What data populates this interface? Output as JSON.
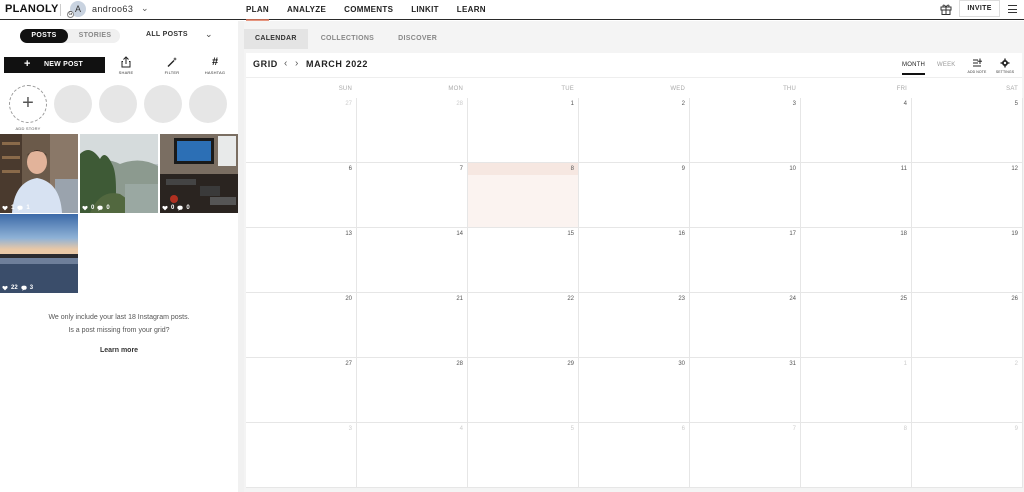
{
  "app": {
    "logo": "PLANOLY",
    "account": {
      "avatar_letter": "A",
      "badge": "G",
      "username": "androo63"
    }
  },
  "nav": {
    "items": [
      "PLAN",
      "ANALYZE",
      "COMMENTS",
      "LINKIT",
      "LEARN"
    ],
    "active": "PLAN"
  },
  "topright": {
    "invite_label": "INVITE"
  },
  "left": {
    "segment": {
      "posts": "POSTS",
      "stories": "STORIES"
    },
    "filter_select": "ALL POSTS",
    "new_post_label": "NEW POST",
    "tools": {
      "share": "SHARE",
      "filter": "FILTER",
      "hashtag": "HASHTAG"
    },
    "add_story_label": "ADD STORY",
    "posts": [
      {
        "likes": "1",
        "comments": "1"
      },
      {
        "likes": "0",
        "comments": "0"
      },
      {
        "likes": "0",
        "comments": "0"
      },
      {
        "likes": "22",
        "comments": "3"
      }
    ],
    "info_line1": "We only include your last 18 Instagram posts.",
    "info_line2": "Is a post missing from your grid?",
    "learn_more": "Learn more"
  },
  "right": {
    "tabs": [
      "CALENDAR",
      "COLLECTIONS",
      "DISCOVER"
    ],
    "active_tab": "CALENDAR",
    "calendar": {
      "view_label": "GRID",
      "month": "MARCH 2022",
      "view_month": "MONTH",
      "view_week": "WEEK",
      "add_note": "ADD NOTE",
      "settings": "SETTINGS",
      "days_of_week": [
        "SUN",
        "MON",
        "TUE",
        "WED",
        "THU",
        "FRI",
        "SAT"
      ],
      "today": "8",
      "weeks": [
        [
          {
            "d": "27",
            "out": true
          },
          {
            "d": "28",
            "out": true
          },
          {
            "d": "1"
          },
          {
            "d": "2"
          },
          {
            "d": "3"
          },
          {
            "d": "4"
          },
          {
            "d": "5"
          }
        ],
        [
          {
            "d": "6"
          },
          {
            "d": "7"
          },
          {
            "d": "8",
            "today": true
          },
          {
            "d": "9"
          },
          {
            "d": "10"
          },
          {
            "d": "11"
          },
          {
            "d": "12"
          }
        ],
        [
          {
            "d": "13"
          },
          {
            "d": "14"
          },
          {
            "d": "15"
          },
          {
            "d": "16"
          },
          {
            "d": "17"
          },
          {
            "d": "18"
          },
          {
            "d": "19"
          }
        ],
        [
          {
            "d": "20"
          },
          {
            "d": "21"
          },
          {
            "d": "22"
          },
          {
            "d": "23"
          },
          {
            "d": "24"
          },
          {
            "d": "25"
          },
          {
            "d": "26"
          }
        ],
        [
          {
            "d": "27"
          },
          {
            "d": "28"
          },
          {
            "d": "29"
          },
          {
            "d": "30"
          },
          {
            "d": "31"
          },
          {
            "d": "1",
            "out": true
          },
          {
            "d": "2",
            "out": true
          }
        ],
        [
          {
            "d": "3",
            "out": true
          },
          {
            "d": "4",
            "out": true
          },
          {
            "d": "5",
            "out": true
          },
          {
            "d": "6",
            "out": true
          },
          {
            "d": "7",
            "out": true
          },
          {
            "d": "8",
            "out": true
          },
          {
            "d": "9",
            "out": true
          }
        ]
      ]
    }
  }
}
